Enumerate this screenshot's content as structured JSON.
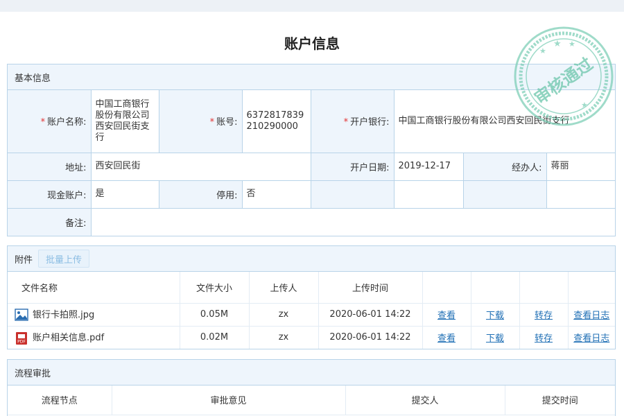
{
  "page": {
    "title": "账户信息",
    "stamp_text": "审核通过"
  },
  "basic": {
    "section_title": "基本信息",
    "account_name": {
      "label": "账户名称:",
      "value": "中国工商银行股份有限公司西安回民街支行"
    },
    "account_no": {
      "label": "账号:",
      "value": "6372817839210290000"
    },
    "bank": {
      "label": "开户银行:",
      "value": "中国工商银行股份有限公司西安回民街支行"
    },
    "address": {
      "label": "地址:",
      "value": "西安回民街"
    },
    "open_date": {
      "label": "开户日期:",
      "value": "2019-12-17"
    },
    "handler": {
      "label": "经办人:",
      "value": "蒋丽"
    },
    "cash_account": {
      "label": "现金账户:",
      "value": "是"
    },
    "disabled": {
      "label": "停用:",
      "value": "否"
    },
    "remark": {
      "label": "备注:",
      "value": ""
    },
    "required_mark": "*"
  },
  "attachments": {
    "section_title": "附件",
    "upload_button": "批量上传",
    "headers": {
      "name": "文件名称",
      "size": "文件大小",
      "uploader": "上传人",
      "time": "上传时间"
    },
    "actions": {
      "view": "查看",
      "download": "下载",
      "transfer": "转存",
      "log": "查看日志"
    },
    "files": [
      {
        "name": "银行卡拍照.jpg",
        "size": "0.05M",
        "uploader": "zx",
        "time": "2020-06-01 14:22",
        "icon": "image-file-icon"
      },
      {
        "name": "账户相关信息.pdf",
        "size": "0.02M",
        "uploader": "zx",
        "time": "2020-06-01 14:22",
        "icon": "pdf-file-icon"
      }
    ]
  },
  "flow": {
    "section_title": "流程审批",
    "headers": {
      "node": "流程节点",
      "opinion": "审批意见",
      "submitter": "提交人",
      "time": "提交时间"
    }
  },
  "colors": {
    "border": "#b8d3e8",
    "label_bg": "#eef5fc",
    "link": "#1f6fb5",
    "stamp": "#7fcfb8",
    "required": "#e23232"
  }
}
